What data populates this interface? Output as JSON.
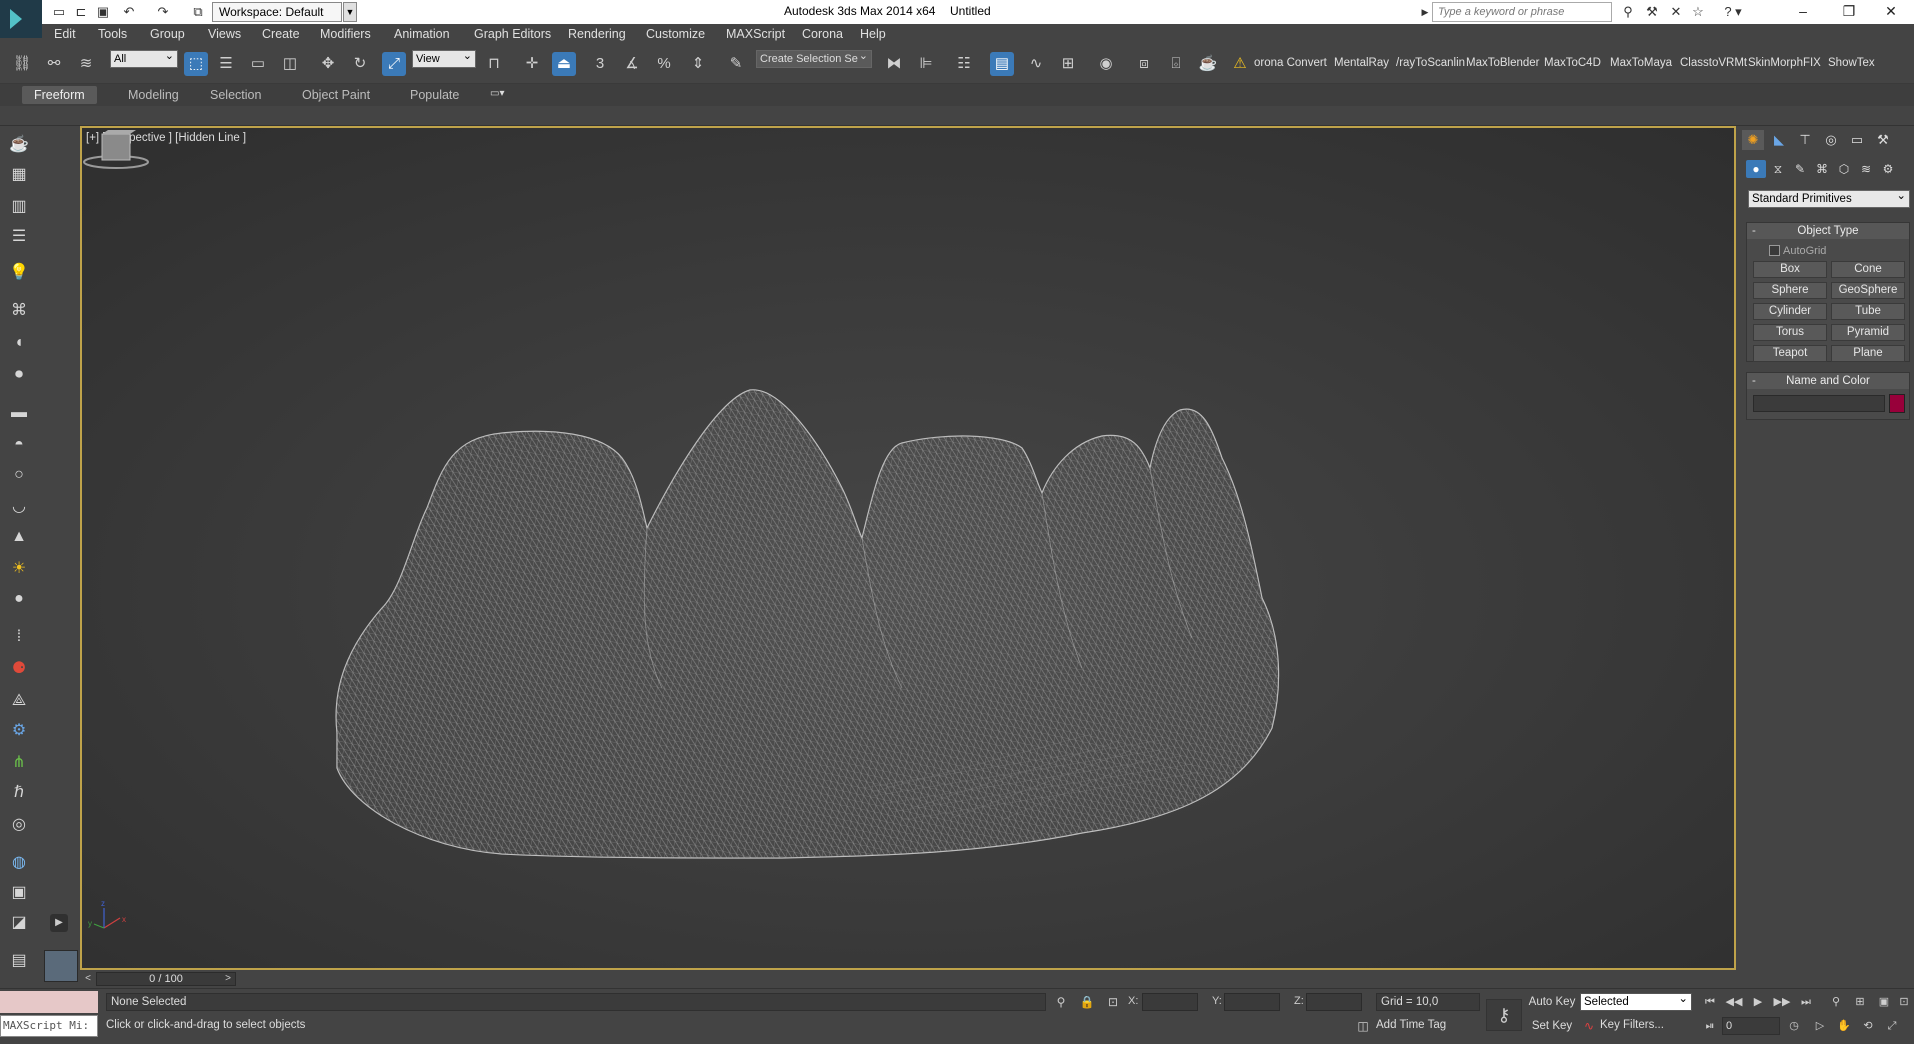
{
  "titlebar": {
    "workspace": "Workspace: Default",
    "app_title": "Autodesk 3ds Max  2014 x64",
    "doc_title": "Untitled",
    "search_placeholder": "Type a keyword or phrase"
  },
  "menu": [
    "Edit",
    "Tools",
    "Group",
    "Views",
    "Create",
    "Modifiers",
    "Animation",
    "Graph Editors",
    "Rendering",
    "Customize",
    "MAXScript",
    "Corona",
    "Help"
  ],
  "toolbar": {
    "selection_filter": "All",
    "ref_coord": "View",
    "snap_angle_label": "3",
    "named_selection": "Create Selection Se",
    "plugins": [
      "orona Convert",
      "MentalRay",
      "/rayToScanlin",
      "MaxToBlender",
      "MaxToC4D",
      "MaxToMaya",
      "ClasstoVRMt",
      "SkinMorphFIX",
      "ShowTex"
    ]
  },
  "ribbon": {
    "tabs": [
      "Freeform",
      "Modeling",
      "Selection",
      "Object Paint",
      "Populate"
    ],
    "active_tab": "Freeform"
  },
  "viewport": {
    "label": "[+] [Perspective ] [Hidden Line ]",
    "active_border_color": "#bfa34a",
    "axis_labels": [
      "x",
      "y",
      "z"
    ]
  },
  "command_panel": {
    "category": "Standard Primitives",
    "object_type_title": "Object Type",
    "autogrid_label": "AutoGrid",
    "primitives": [
      "Box",
      "Cone",
      "Sphere",
      "GeoSphere",
      "Cylinder",
      "Tube",
      "Torus",
      "Pyramid",
      "Teapot",
      "Plane"
    ],
    "name_color_title": "Name and Color",
    "object_color": "#98003a"
  },
  "timeslider": {
    "frame_text": "0 / 100",
    "prev": "<",
    "next": ">"
  },
  "status": {
    "maxscript_listener": "MAXScript Mi:",
    "selection_status": "None Selected",
    "prompt": "Click or click-and-drag to select objects",
    "x_label": "X:",
    "y_label": "Y:",
    "z_label": "Z:",
    "grid": "Grid = 10,0",
    "add_time_tag": "Add Time Tag",
    "auto_key": "Auto Key",
    "set_key": "Set Key",
    "key_mode": "Selected",
    "key_filters": "Key Filters...",
    "current_frame": "0"
  }
}
